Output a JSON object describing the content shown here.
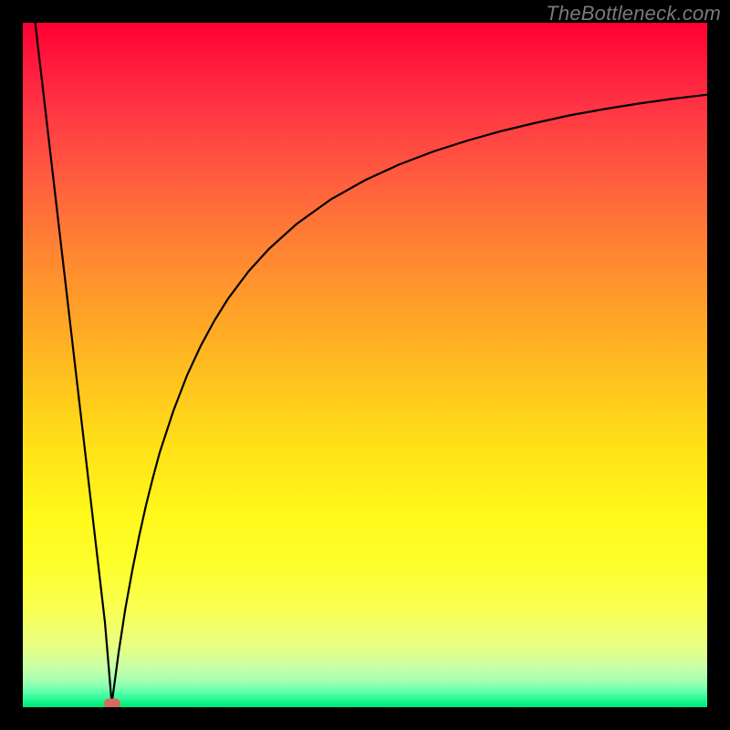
{
  "watermark": {
    "text": "TheBottleneck.com"
  },
  "colors": {
    "marker": "#d86a5f",
    "curve": "#000000",
    "frame": "#000000"
  },
  "chart_data": {
    "type": "line",
    "title": "",
    "xlabel": "",
    "ylabel": "",
    "xlim": [
      0,
      100
    ],
    "ylim": [
      0,
      100
    ],
    "grid": false,
    "curve_description": "V-shaped curve: left branch descends steeply from top-left to a cusp near x≈13, y≈0; right branch rises concavely from the cusp toward the upper-right, approaching y≈90 at x=100. Gradient background encodes value from red (top/high) to green (bottom/low).",
    "marker": {
      "x": 13,
      "y": 0.5
    },
    "x": [
      0,
      1,
      2,
      3,
      4,
      5,
      6,
      7,
      8,
      9,
      10,
      11,
      12,
      13,
      14,
      15,
      16,
      17,
      18,
      19,
      20,
      22,
      24,
      26,
      28,
      30,
      33,
      36,
      40,
      45,
      50,
      55,
      60,
      65,
      70,
      75,
      80,
      85,
      90,
      95,
      100
    ],
    "y": [
      116,
      107,
      98.4,
      89.8,
      81.2,
      72.6,
      64,
      55.4,
      46.8,
      38.2,
      29.6,
      21,
      12.4,
      0.5,
      8,
      14.5,
      20,
      25,
      29.5,
      33.5,
      37.2,
      43.3,
      48.5,
      52.8,
      56.5,
      59.7,
      63.7,
      67,
      70.6,
      74.2,
      77,
      79.3,
      81.2,
      82.8,
      84.2,
      85.4,
      86.5,
      87.4,
      88.2,
      88.9,
      89.5
    ]
  }
}
